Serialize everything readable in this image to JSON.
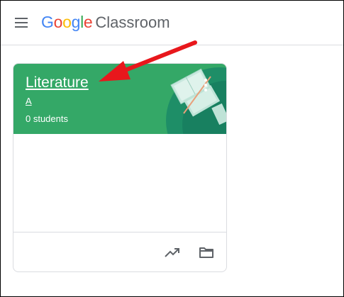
{
  "header": {
    "logo_brand": [
      "G",
      "o",
      "o",
      "g",
      "l",
      "e"
    ],
    "logo_brand_colors": [
      "#4285f4",
      "#ea4335",
      "#fbbc05",
      "#4285f4",
      "#34a853",
      "#ea4335"
    ],
    "logo_product": "Classroom",
    "menu_icon": "hamburger-menu-icon"
  },
  "class_card": {
    "title": "Literature",
    "section": "A",
    "students": "0 students",
    "header_color": "#34a867",
    "more_icon": "more-vert-icon",
    "footer_icons": [
      "trending-up-icon",
      "folder-icon"
    ]
  },
  "annotation": {
    "arrow_color": "#e8171c"
  }
}
